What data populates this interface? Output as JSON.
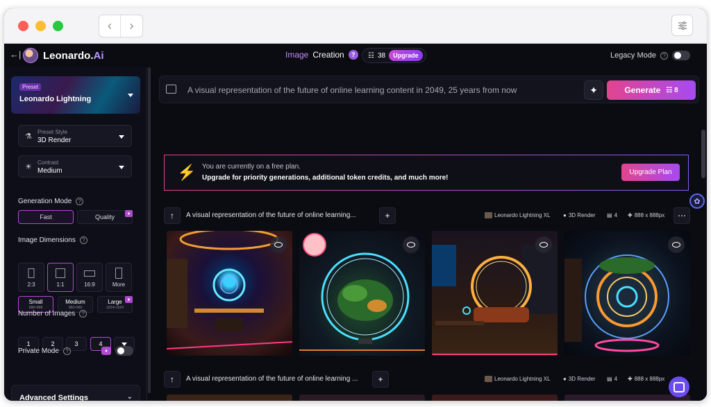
{
  "app": {
    "brand_name": "Leonardo.",
    "brand_suffix": "Ai",
    "page_prefix": "Image",
    "page_title": "Creation",
    "token_count": "38",
    "upgrade_label": "Upgrade",
    "legacy_mode_label": "Legacy Mode",
    "legacy_mode_on": false
  },
  "sidebar": {
    "preset": {
      "label": "Preset",
      "value": "Leonardo Lightning"
    },
    "preset_style": {
      "label": "Preset Style",
      "value": "3D Render"
    },
    "contrast": {
      "label": "Contrast",
      "value": "Medium"
    },
    "generation_mode": {
      "label": "Generation Mode",
      "options": [
        "Fast",
        "Quality"
      ],
      "selected": "Fast"
    },
    "image_dimensions": {
      "label": "Image Dimensions",
      "ratios": [
        "2:3",
        "1:1",
        "16:9",
        "More"
      ],
      "selected_ratio": "1:1",
      "sizes": [
        {
          "label": "Small",
          "sub": "888×888"
        },
        {
          "label": "Medium",
          "sub": "960×960"
        },
        {
          "label": "Large",
          "sub": "1024×1024"
        }
      ],
      "selected_size": "Small"
    },
    "number_of_images": {
      "label": "Number of Images",
      "options": [
        "1",
        "2",
        "3",
        "4"
      ],
      "selected": "4"
    },
    "private_mode": {
      "label": "Private Mode",
      "on": false
    },
    "advanced_settings_label": "Advanced Settings"
  },
  "prompt": {
    "text": "A visual representation of the future of online learning content in 2049, 25 years from now",
    "generate_label": "Generate",
    "generate_cost": "8"
  },
  "banner": {
    "line1": "You are currently on a free plan.",
    "line2": "Upgrade for priority generations, additional token credits, and much more!",
    "button": "Upgrade Plan"
  },
  "generations": [
    {
      "prompt": "A visual representation of the future of online learning...",
      "model": "Leonardo Lightning XL",
      "style": "3D Render",
      "count": "4",
      "size": "888 x 888px"
    },
    {
      "prompt": "A visual representation of the future of online learning ...",
      "model": "Leonardo Lightning XL",
      "style": "3D Render",
      "count": "4",
      "size": "888 x 888px"
    }
  ],
  "colors": {
    "accent_pink": "#e2448e",
    "accent_purple": "#a64bf0",
    "bg": "#0b0b12"
  }
}
